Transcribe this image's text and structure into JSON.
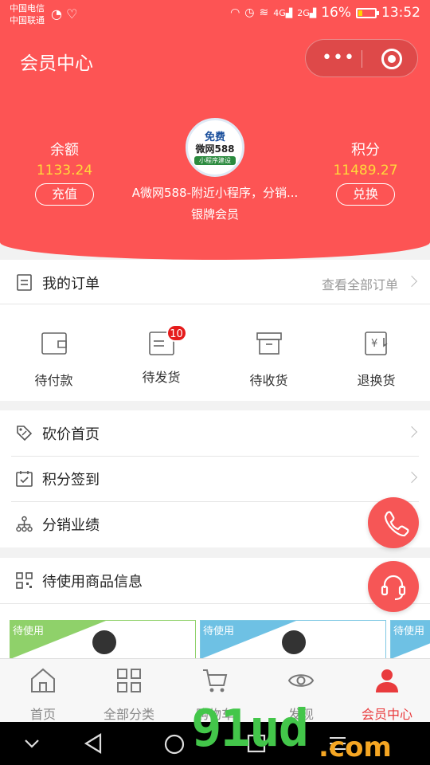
{
  "status_bar": {
    "carrier1": "中国电信",
    "carrier2": "中国联通",
    "battery": "16%",
    "time": "13:52"
  },
  "header": {
    "title": "会员中心",
    "balance_label": "余额",
    "balance_value": "1133.24",
    "recharge_label": "充值",
    "points_label": "积分",
    "points_value": "11489.27",
    "exchange_label": "兑换",
    "avatar_text1": "免费",
    "avatar_text2": "微网588",
    "avatar_text3": "小程序建设",
    "nickname": "A微网588-附近小程序，分销...",
    "level": "银牌会员"
  },
  "orders": {
    "title": "我的订单",
    "view_all": "查看全部订单",
    "items": [
      {
        "label": "待付款",
        "icon": "wallet-icon"
      },
      {
        "label": "待发货",
        "icon": "invoice-icon",
        "badge": "10"
      },
      {
        "label": "待收货",
        "icon": "box-icon"
      },
      {
        "label": "退换货",
        "icon": "refund-icon"
      }
    ]
  },
  "menu": {
    "bargain": "砍价首页",
    "checkin": "积分签到",
    "distribution": "分销业绩"
  },
  "unused": {
    "title": "待使用商品信息",
    "cards": [
      {
        "tag": "待使用",
        "color": "#8fd16a"
      },
      {
        "tag": "待使用",
        "color": "#6ec1e4"
      },
      {
        "tag": "待使用",
        "color": "#6ec1e4"
      }
    ]
  },
  "tabbar": {
    "items": [
      {
        "label": "首页",
        "icon": "home-icon"
      },
      {
        "label": "全部分类",
        "icon": "grid-icon"
      },
      {
        "label": "购物车",
        "icon": "cart-icon"
      },
      {
        "label": "发现",
        "icon": "eye-icon"
      },
      {
        "label": "会员中心",
        "icon": "user-icon"
      }
    ],
    "active_color": "#e93b3d"
  },
  "watermark": {
    "brand": "91ud",
    "domain": ".com"
  },
  "colors": {
    "primary": "#fd5454",
    "balance": "#ffd93a"
  }
}
